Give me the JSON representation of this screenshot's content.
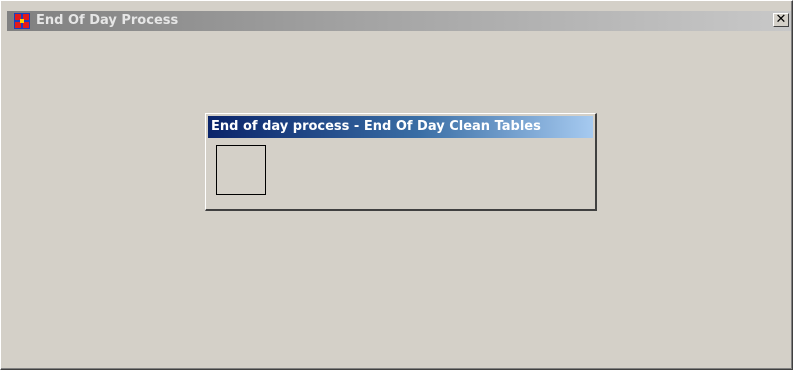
{
  "window": {
    "title": "End Of Day Process",
    "close_symbol": "✕",
    "icon": "application-icon"
  },
  "dialog": {
    "title": "End of day process - End Of Day Clean Tables",
    "progress_indicator": "empty-box"
  },
  "colors": {
    "window_background": "#d4d0c8",
    "inactive_titlebar": "#808080",
    "dialog_titlebar_start": "#0a246a",
    "dialog_titlebar_end": "#a6caf0"
  }
}
